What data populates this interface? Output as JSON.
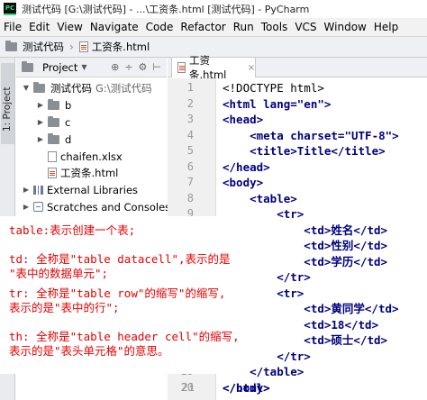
{
  "window": {
    "app_icon": "PC",
    "title": "测试代码 [G:\\测试代码] - ...\\工资条.html [测试代码] - PyCharm"
  },
  "menu": [
    "File",
    "Edit",
    "View",
    "Navigate",
    "Code",
    "Refactor",
    "Run",
    "Tools",
    "VCS",
    "Window",
    "Help"
  ],
  "breadcrumb": {
    "project": "测试代码",
    "file": "工资条.html"
  },
  "side_panel": {
    "label": "1: Project"
  },
  "project_panel": {
    "header": "Project",
    "tools": [
      "⊕",
      "÷",
      "⚙",
      "⊢"
    ],
    "root": {
      "name": "测试代码",
      "path": "G:\\测试代码"
    },
    "folders": [
      "b",
      "c",
      "d"
    ],
    "files": [
      "chaifen.xlsx",
      "工资条.html"
    ],
    "external_libraries": "External Libraries",
    "scratches": "Scratches and Consoles"
  },
  "editor": {
    "tab": "工资条.html",
    "tab_close": "×",
    "line_numbers": [
      "1",
      "2",
      "3",
      "4",
      "5",
      "6",
      "7",
      "8",
      "9",
      "10",
      "11",
      "12",
      "13",
      "14",
      "15",
      "16",
      "17",
      "18",
      "19",
      "20",
      "21"
    ],
    "lines": [
      "<!DOCTYPE html>",
      "<html lang=\"en\">",
      "<head>",
      "    <meta charset=\"UTF-8\">",
      "    <title>Title</title>",
      "</head>",
      "<body>",
      "    <table>",
      "        <tr>",
      "            <td>姓名</td>",
      "            <td>性别</td>",
      "            <td>学历</td>",
      "        </tr>",
      "        <tr>",
      "            <td>黄同学</td>",
      "            <td>18</td>",
      "            <td>硕士</td>",
      "        </tr>",
      "    </table>",
      "</body>",
      "</html>"
    ]
  },
  "annotations": [
    "table:表示创建一个表;",
    "td: 全称是\"table datacell\",表示的是",
    "\"表中的数据单元\";",
    "tr: 全称是\"table row\"的缩写\"的缩写,",
    "表示的是\"表中的行\";",
    "th: 全称是\"table header cell\"的缩写,",
    "表示的是\"表头单元格\"的意思。"
  ],
  "colors": {
    "tag": "#000080",
    "attr": "#0000ff",
    "value": "#008000",
    "annotation": "#e60000"
  }
}
